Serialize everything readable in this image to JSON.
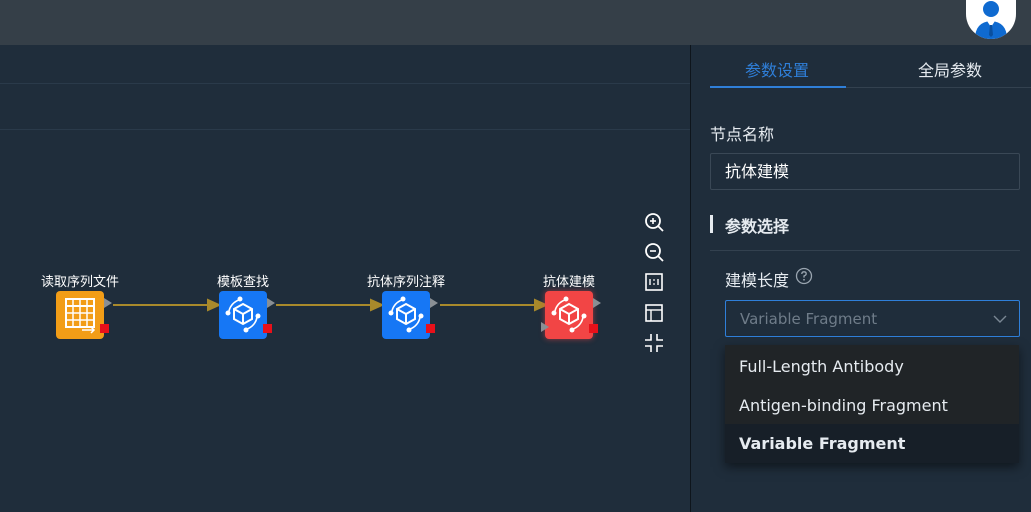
{
  "header": {
    "avatar_icon": "user-avatar-icon"
  },
  "workflow": {
    "nodes": [
      {
        "label": "读取序列文件",
        "icon": "table-file-icon",
        "color": "#f29d17"
      },
      {
        "label": "模板查找",
        "icon": "molecule-icon",
        "color": "#1677f5"
      },
      {
        "label": "抗体序列注释",
        "icon": "molecule-icon",
        "color": "#1677f5"
      },
      {
        "label": "抗体建模",
        "icon": "molecule-icon",
        "color": "#f24545"
      }
    ],
    "edge_color": "#a8892b",
    "tools": [
      "zoom-in-icon",
      "zoom-out-icon",
      "fit-view-icon",
      "layout-icon",
      "collapse-icon"
    ]
  },
  "panel": {
    "tabs": [
      {
        "label": "参数设置",
        "active": true
      },
      {
        "label": "全局参数",
        "active": false
      }
    ],
    "node_name_label": "节点名称",
    "node_name_value": "抗体建模",
    "section_title": "参数选择",
    "param_label": "建模长度",
    "select_placeholder": "Variable Fragment",
    "options": [
      {
        "label": "Full-Length Antibody",
        "selected": false
      },
      {
        "label": "Antigen-binding Fragment",
        "selected": false
      },
      {
        "label": "Variable Fragment",
        "selected": true
      }
    ],
    "accent": "#2f7fd9"
  }
}
